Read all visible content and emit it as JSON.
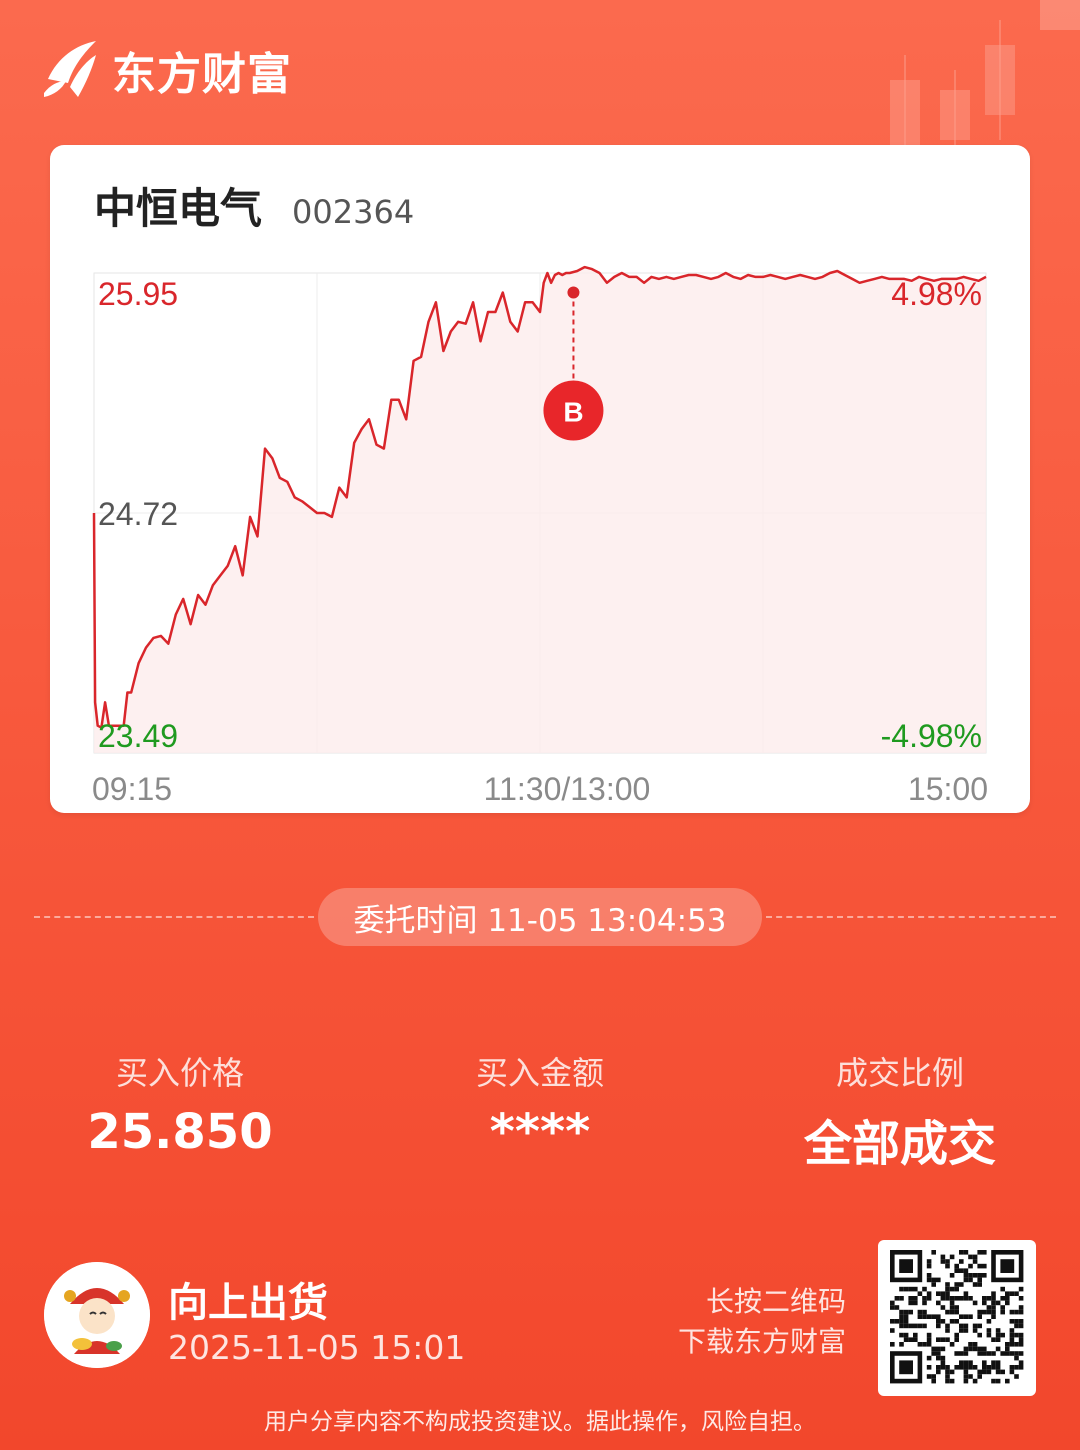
{
  "brand": {
    "name": "东方财富"
  },
  "stock": {
    "name": "中恒电气",
    "code": "002364"
  },
  "chart_data": {
    "type": "line",
    "y_tick_labels": {
      "top": "25.95",
      "mid": "24.72",
      "bottom": "23.49"
    },
    "pct_labels": {
      "top": "4.98%",
      "bottom": "-4.98%"
    },
    "x_tick_labels": {
      "start": "09:15",
      "mid": "11:30/13:00",
      "end": "15:00"
    },
    "ylim": [
      23.49,
      25.95
    ],
    "xlim": [
      0,
      240
    ],
    "colors": {
      "line": "#d9262b",
      "up": "#d9262b",
      "down": "#1f9a1f",
      "neutral": "#555555"
    },
    "series": [
      {
        "x": [
          0,
          0.3,
          1,
          2,
          3,
          4,
          5,
          6,
          7,
          8,
          9,
          10,
          12,
          14,
          16,
          18,
          20,
          22,
          24,
          26,
          28,
          30,
          32,
          34,
          36,
          38,
          40,
          42,
          44,
          46,
          48,
          50,
          52,
          54,
          56,
          58,
          60,
          62,
          64,
          66,
          68,
          70,
          72,
          74,
          76,
          78,
          80,
          82,
          84,
          86,
          88,
          90,
          92,
          94,
          96,
          98,
          100,
          102,
          104,
          106,
          108,
          110,
          112,
          114,
          116,
          118,
          120,
          121,
          122,
          123,
          124,
          125,
          126,
          127,
          128,
          130,
          132,
          134,
          136,
          138,
          140,
          142,
          144,
          146,
          148,
          150,
          152,
          154,
          156,
          158,
          160,
          162,
          164,
          166,
          168,
          170,
          172,
          174,
          176,
          178,
          180,
          182,
          184,
          186,
          188,
          190,
          192,
          194,
          196,
          198,
          200,
          202,
          204,
          206,
          208,
          210,
          212,
          214,
          216,
          218,
          220,
          222,
          224,
          226,
          228,
          230,
          232,
          234,
          236,
          238,
          240
        ],
        "values": [
          24.72,
          23.75,
          23.63,
          23.62,
          23.75,
          23.63,
          23.63,
          23.63,
          23.63,
          23.63,
          23.8,
          23.8,
          23.95,
          24.03,
          24.08,
          24.09,
          24.05,
          24.2,
          24.28,
          24.15,
          24.3,
          24.25,
          24.35,
          24.4,
          24.45,
          24.55,
          24.4,
          24.7,
          24.6,
          25.05,
          25.0,
          24.9,
          24.88,
          24.8,
          24.78,
          24.75,
          24.72,
          24.72,
          24.7,
          24.85,
          24.8,
          25.08,
          25.15,
          25.2,
          25.07,
          25.05,
          25.3,
          25.3,
          25.2,
          25.5,
          25.52,
          25.7,
          25.8,
          25.55,
          25.65,
          25.7,
          25.69,
          25.8,
          25.6,
          25.75,
          25.75,
          25.85,
          25.7,
          25.65,
          25.8,
          25.8,
          25.75,
          25.9,
          25.95,
          25.9,
          25.94,
          25.95,
          25.94,
          25.95,
          25.95,
          25.96,
          25.98,
          25.97,
          25.95,
          25.9,
          25.93,
          25.95,
          25.93,
          25.93,
          25.9,
          25.93,
          25.92,
          25.93,
          25.92,
          25.93,
          25.94,
          25.94,
          25.93,
          25.92,
          25.93,
          25.95,
          25.93,
          25.92,
          25.94,
          25.93,
          25.93,
          25.94,
          25.93,
          25.92,
          25.93,
          25.94,
          25.93,
          25.92,
          25.93,
          25.95,
          25.96,
          25.94,
          25.92,
          25.9,
          25.91,
          25.92,
          25.93,
          25.92,
          25.92,
          25.92,
          25.91,
          25.93,
          25.92,
          25.91,
          25.92,
          25.92,
          25.92,
          25.93,
          25.92,
          25.91,
          25.93
        ]
      }
    ],
    "marker": {
      "label": "B",
      "x": 129,
      "y": 25.85
    }
  },
  "order": {
    "time_text": "委托时间 11-05 13:04:53"
  },
  "stats": [
    {
      "label": "买入价格",
      "value": "25.850"
    },
    {
      "label": "买入金额",
      "value": "****"
    },
    {
      "label": "成交比例",
      "value": "全部成交"
    }
  ],
  "user": {
    "name": "向上出货",
    "date": "2025-11-05 15:01"
  },
  "qr": {
    "hint_line1": "长按二维码",
    "hint_line2": "下载东方财富"
  },
  "footer": {
    "disclaimer": "用户分享内容不构成投资建议。据此操作，风险自担。"
  }
}
